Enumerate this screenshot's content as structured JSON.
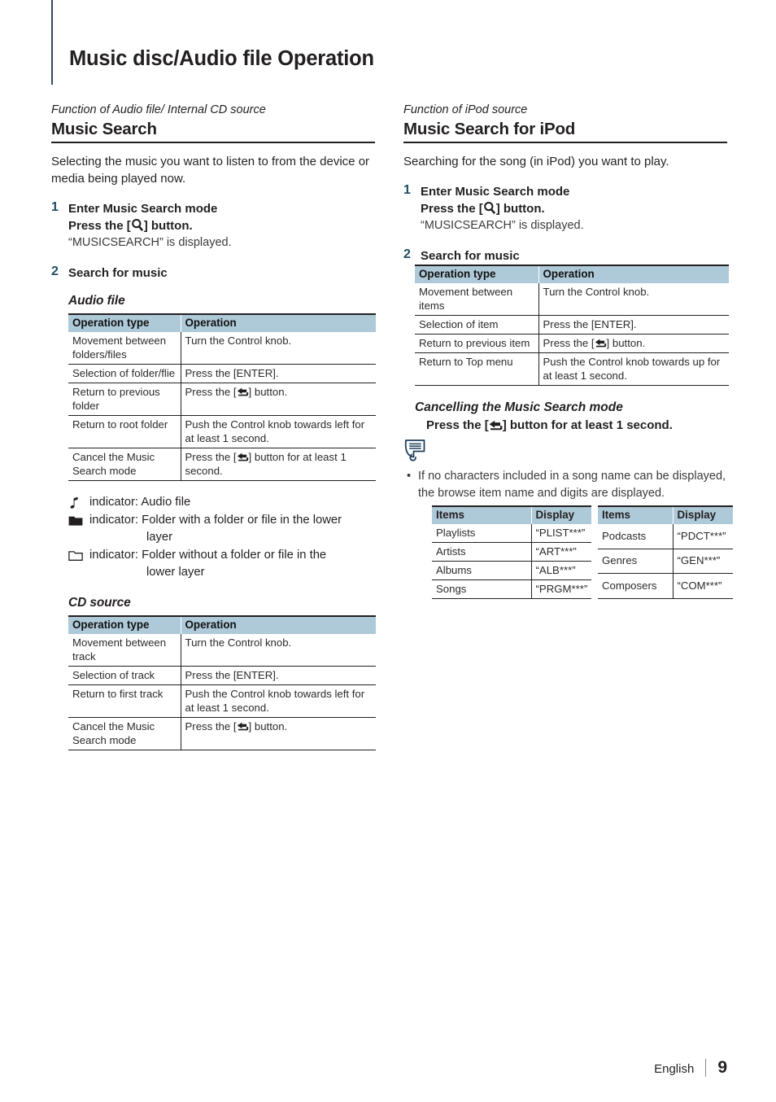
{
  "page": {
    "title": "Music disc/Audio file Operation",
    "footer": {
      "language": "English",
      "page_number": "9",
      "separator": "|"
    }
  },
  "left_column": {
    "eyebrow": "Function of Audio file/ Internal CD source",
    "section_title": "Music Search",
    "intro": "Selecting the music you want to listen to from the device or media being played now.",
    "steps": [
      {
        "number": "1",
        "head": "Enter Music Search mode",
        "sub_prefix": "Press the [",
        "sub_suffix": "] button.",
        "sub_icon": "search-icon",
        "note": "“MUSICSEARCH” is displayed."
      },
      {
        "number": "2",
        "head": "Search for music"
      }
    ],
    "audio_file": {
      "subhead": "Audio file",
      "columns": [
        "Operation type",
        "Operation"
      ],
      "rows": [
        {
          "type": "Movement between folders/files",
          "op": "Turn the Control knob."
        },
        {
          "type": "Selection of folder/flie",
          "op": "Press the [ENTER]."
        },
        {
          "type": "Return to previous folder",
          "op_prefix": "Press the [",
          "op_suffix": "] button.",
          "op_icon": "back-arrow-icon"
        },
        {
          "type": "Return to root folder",
          "op": "Push the Control knob towards left for at least 1 second."
        },
        {
          "type": "Cancel the Music Search mode",
          "op_prefix": "Press the [",
          "op_suffix": "] button for at least 1 second.",
          "op_icon": "back-arrow-icon"
        }
      ]
    },
    "indicators": [
      {
        "icon": "music-note-icon",
        "text": "indicator: Audio file"
      },
      {
        "icon": "folder-filled-icon",
        "text": "indicator: Folder with a folder or file in the lower",
        "text2": "layer"
      },
      {
        "icon": "folder-outline-icon",
        "text": "indicator: Folder without a folder or file in the",
        "text2": "lower layer"
      }
    ],
    "cd_source": {
      "subhead": "CD source",
      "columns": [
        "Operation type",
        "Operation"
      ],
      "rows": [
        {
          "type": "Movement between track",
          "op": "Turn the Control knob."
        },
        {
          "type": "Selection of track",
          "op": "Press the [ENTER]."
        },
        {
          "type": "Return to first track",
          "op": "Push the Control knob towards left for at least 1 second."
        },
        {
          "type": "Cancel the Music Search mode",
          "op_prefix": "Press the [",
          "op_suffix": "] button.",
          "op_icon": "back-arrow-icon"
        }
      ]
    }
  },
  "right_column": {
    "eyebrow": "Function of iPod source",
    "section_title": "Music Search for iPod",
    "intro": "Searching for the song (in iPod) you want to play.",
    "steps": [
      {
        "number": "1",
        "head": "Enter Music Search mode",
        "sub_prefix": "Press the [",
        "sub_suffix": "] button.",
        "sub_icon": "search-icon",
        "note": "“MUSICSEARCH” is displayed."
      },
      {
        "number": "2",
        "head": "Search for music"
      }
    ],
    "ipod_table": {
      "columns": [
        "Operation type",
        "Operation"
      ],
      "rows": [
        {
          "type": "Movement between items",
          "op": "Turn the Control knob."
        },
        {
          "type": "Selection of item",
          "op": "Press the [ENTER]."
        },
        {
          "type": "Return to previous item",
          "op_prefix": "Press the [",
          "op_suffix": "] button.",
          "op_icon": "back-arrow-icon"
        },
        {
          "type": "Return to Top menu",
          "op": "Push the Control knob towards up for at least 1 second."
        }
      ]
    },
    "cancelling": {
      "head": "Cancelling the Music Search mode",
      "line_prefix": "Press the [",
      "line_suffix": "] button for at least 1 second.",
      "line_icon": "back-arrow-icon"
    },
    "note": {
      "icon": "note-bubble-icon",
      "bullet": "•",
      "text": "If no characters included in a song name can be displayed, the browse item name and digits are displayed."
    },
    "items_table_left": {
      "columns": [
        "Items",
        "Display"
      ],
      "rows": [
        {
          "item": "Playlists",
          "display": "“PLIST***”"
        },
        {
          "item": "Artists",
          "display": "“ART***”"
        },
        {
          "item": "Albums",
          "display": "“ALB***”"
        },
        {
          "item": "Songs",
          "display": "“PRGM***”"
        }
      ]
    },
    "items_table_right": {
      "columns": [
        "Items",
        "Display"
      ],
      "rows": [
        {
          "item": "Podcasts",
          "display": "“PDCT***”"
        },
        {
          "item": "Genres",
          "display": "“GEN***”"
        },
        {
          "item": "Composers",
          "display": "“COM***”"
        }
      ]
    }
  },
  "colors": {
    "table_header_bg": "#aec9d8",
    "step_number": "#1f4e63",
    "title_rule": "#2e4a63",
    "note_icon": "#1f3f5c",
    "text": "#231f20"
  }
}
